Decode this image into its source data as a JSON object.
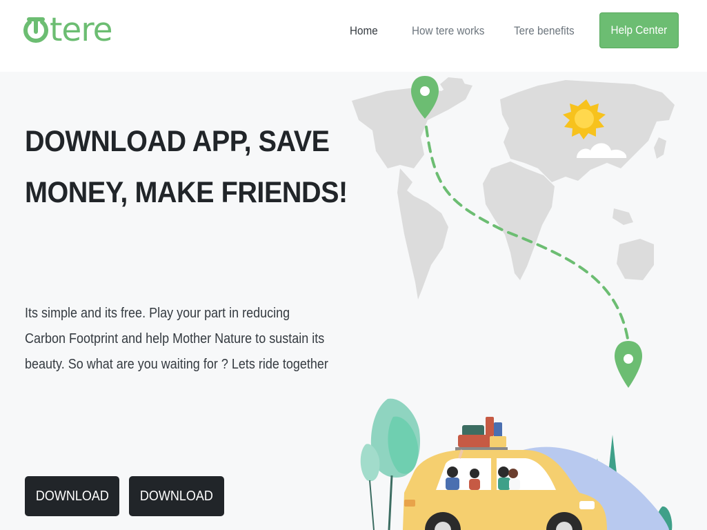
{
  "brand": {
    "name": "tere",
    "color": "#6cbd72"
  },
  "nav": {
    "items": [
      {
        "label": "Home",
        "active": true
      },
      {
        "label": "How tere works",
        "active": false
      },
      {
        "label": "Tere benefits",
        "active": false
      }
    ],
    "cta_label": "Help Center"
  },
  "hero": {
    "title_line1": "DOWNLOAD APP, SAVE",
    "title_line2": "MONEY, MAKE FRIENDS!",
    "description": "Its simple and its free. Play your part in reducing Carbon Footprint and help Mother Nature to sustain its beauty. So what are you waiting for ? Lets ride together",
    "download_buttons": [
      "DOWNLOAD",
      "DOWNLOAD"
    ]
  },
  "colors": {
    "accent": "#6cbd72",
    "dark": "#212529",
    "map": "#dcdcdc",
    "car": "#f5cf6f",
    "sun": "#f7c21d"
  }
}
